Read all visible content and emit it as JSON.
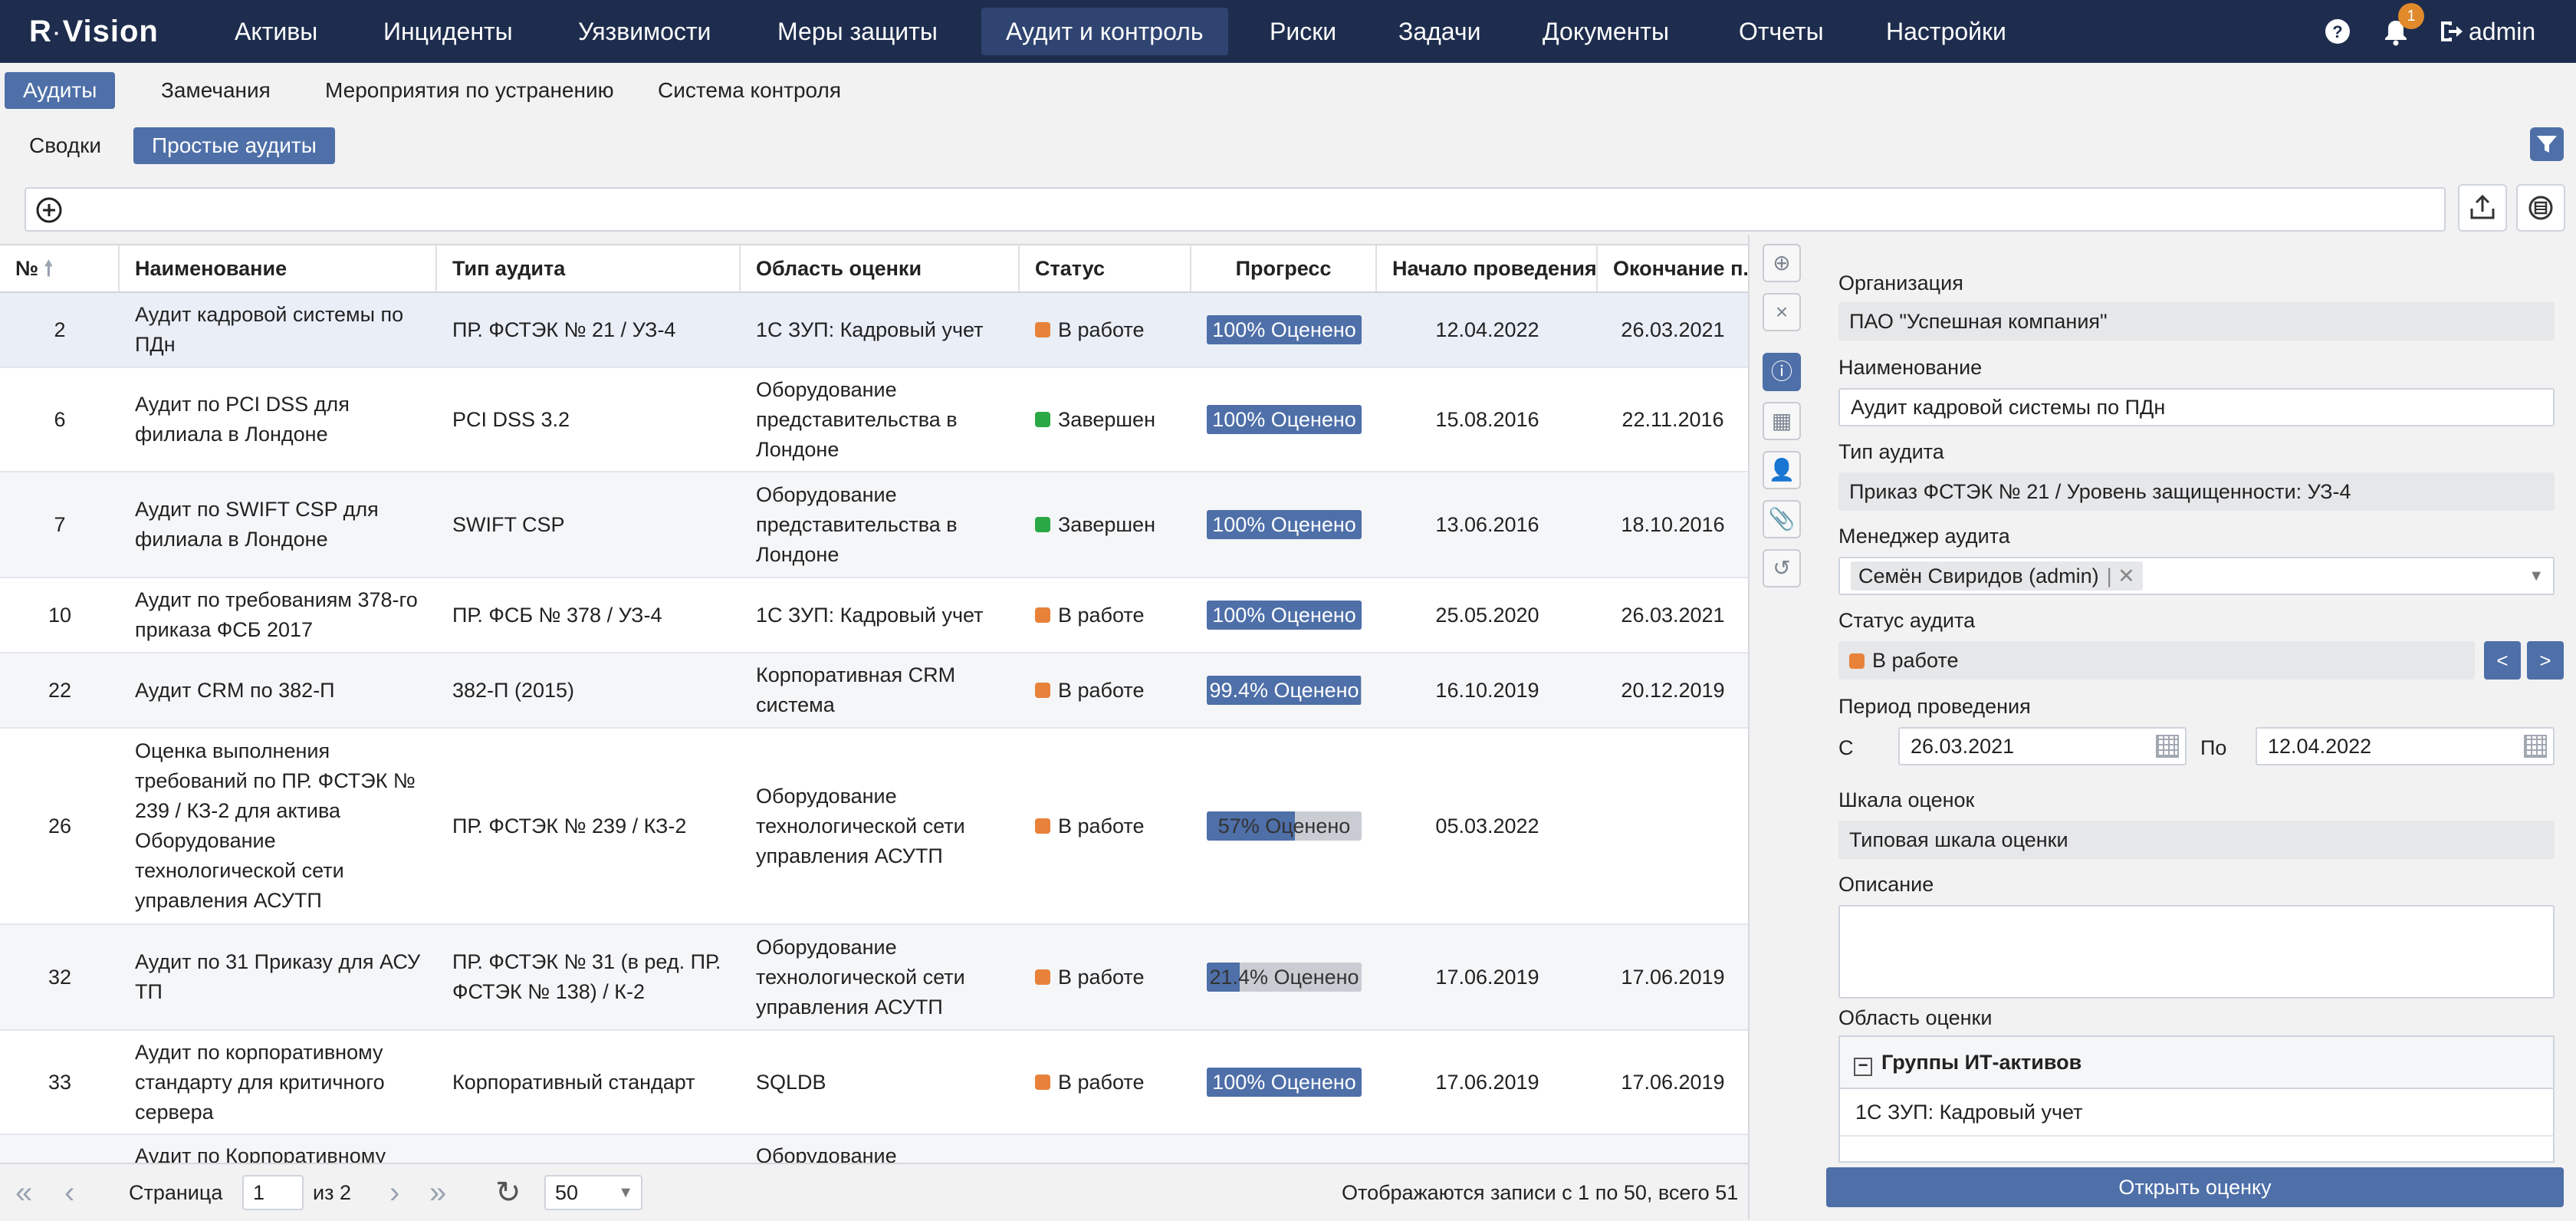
{
  "app": {
    "logo_r": "R",
    "logo_name": "Vision",
    "user": "admin",
    "notifications": "1"
  },
  "nav": {
    "items": [
      "Активы",
      "Инциденты",
      "Уязвимости",
      "Меры защиты",
      "Аудит и контроль",
      "Риски",
      "Задачи",
      "Документы",
      "Отчеты",
      "Настройки"
    ],
    "active": "Аудит и контроль"
  },
  "tabs": {
    "primary": [
      "Аудиты",
      "Замечания",
      "Мероприятия по устранению",
      "Система контроля"
    ],
    "secondary": [
      "Сводки",
      "Простые аудиты"
    ]
  },
  "search": {
    "value": ""
  },
  "grid": {
    "columns": [
      "№",
      "Наименование",
      "Тип аудита",
      "Область оценки",
      "Статус",
      "Прогресс",
      "Начало проведения",
      "Окончание п..."
    ],
    "rows": [
      {
        "num": "2",
        "name": "Аудит кадровой системы по ПДн",
        "type": "ПР. ФСТЭК № 21 / УЗ-4",
        "scope": "1С ЗУП: Кадровый учет",
        "status": "В работе",
        "status_color": "#e8823a",
        "progress": 100,
        "progress_label": "100% Оценено",
        "start": "12.04.2022",
        "end": "26.03.2021"
      },
      {
        "num": "6",
        "name": "Аудит по PCI DSS для филиала в Лондоне",
        "type": "PCI DSS 3.2",
        "scope": "Оборудование представительства в Лондоне",
        "status": "Завершен",
        "status_color": "#2aa845",
        "progress": 100,
        "progress_label": "100% Оценено",
        "start": "15.08.2016",
        "end": "22.11.2016"
      },
      {
        "num": "7",
        "name": "Аудит по SWIFT CSP для филиала в Лондоне",
        "type": "SWIFT CSP",
        "scope": "Оборудование представительства в Лондоне",
        "status": "Завершен",
        "status_color": "#2aa845",
        "progress": 100,
        "progress_label": "100% Оценено",
        "start": "13.06.2016",
        "end": "18.10.2016"
      },
      {
        "num": "10",
        "name": "Аудит по требованиям 378-го приказа ФСБ 2017",
        "type": "ПР. ФСБ № 378 / УЗ-4",
        "scope": "1С ЗУП: Кадровый учет",
        "status": "В работе",
        "status_color": "#e8823a",
        "progress": 100,
        "progress_label": "100% Оценено",
        "start": "25.05.2020",
        "end": "26.03.2021"
      },
      {
        "num": "22",
        "name": "Аудит CRM по 382-П",
        "type": "382-П (2015)",
        "scope": "Корпоративная CRM система",
        "status": "В работе",
        "status_color": "#e8823a",
        "progress": 99.4,
        "progress_label": "99.4% Оценено",
        "start": "16.10.2019",
        "end": "20.12.2019"
      },
      {
        "num": "26",
        "name": "Оценка выполнения требований по ПР. ФСТЭК № 239 / КЗ-2 для актива Оборудование технологической сети управления АСУТП",
        "type": "ПР. ФСТЭК № 239 / КЗ-2",
        "scope": "Оборудование технологической сети управления АСУТП",
        "status": "В работе",
        "status_color": "#e8823a",
        "progress": 57,
        "progress_label": "57% Оценено",
        "start": "05.03.2022",
        "end": ""
      },
      {
        "num": "32",
        "name": "Аудит по 31 Приказу для АСУ ТП",
        "type": "ПР. ФСТЭК № 31 (в ред. ПР. ФСТЭК № 138) / К-2",
        "scope": "Оборудование технологической сети управления АСУТП",
        "status": "В работе",
        "status_color": "#e8823a",
        "progress": 21.4,
        "progress_label": "21.4% Оценено",
        "start": "17.06.2019",
        "end": "17.06.2019"
      },
      {
        "num": "33",
        "name": "Аудит по корпоративному стандарту для критичного сервера",
        "type": "Корпоративный стандарт",
        "scope": "SQLDB",
        "status": "В работе",
        "status_color": "#e8823a",
        "progress": 100,
        "progress_label": "100% Оценено",
        "start": "17.06.2019",
        "end": "17.06.2019"
      },
      {
        "num": "",
        "name": "Аудит по Корпоративному",
        "type": "",
        "scope": "Оборудование",
        "status": "",
        "status_color": "",
        "progress": null,
        "progress_label": "",
        "start": "",
        "end": ""
      }
    ]
  },
  "pager": {
    "page_label": "Страница",
    "page": "1",
    "of": "из 2",
    "page_size": "50",
    "summary": "Отображаются записи с 1 по 50, всего 51"
  },
  "detail": {
    "org_label": "Организация",
    "org": "ПАО \"Успешная компания\"",
    "name_label": "Наименование",
    "name": "Аудит кадровой системы по ПДн",
    "type_label": "Тип аудита",
    "type": "Приказ ФСТЭК № 21 / Уровень защищенности: УЗ-4",
    "manager_label": "Менеджер аудита",
    "manager": "Семён Свиридов (admin)",
    "status_label": "Статус аудита",
    "status": "В работе",
    "period_label": "Период проведения",
    "from_label": "С",
    "from": "26.03.2021",
    "to_label": "По",
    "to": "12.04.2022",
    "scale_label": "Шкала оценок",
    "scale": "Типовая шкала оценки",
    "desc_label": "Описание",
    "scope_label": "Область оценки",
    "scope_group": "Группы ИТ-активов",
    "scope_item": "1С ЗУП: Кадровый учет",
    "open_button": "Открыть оценку"
  },
  "colors": {
    "nav_bg": "#1e2d4e",
    "accent": "#4e6fa8",
    "in_work": "#e8823a",
    "done": "#2aa845"
  }
}
